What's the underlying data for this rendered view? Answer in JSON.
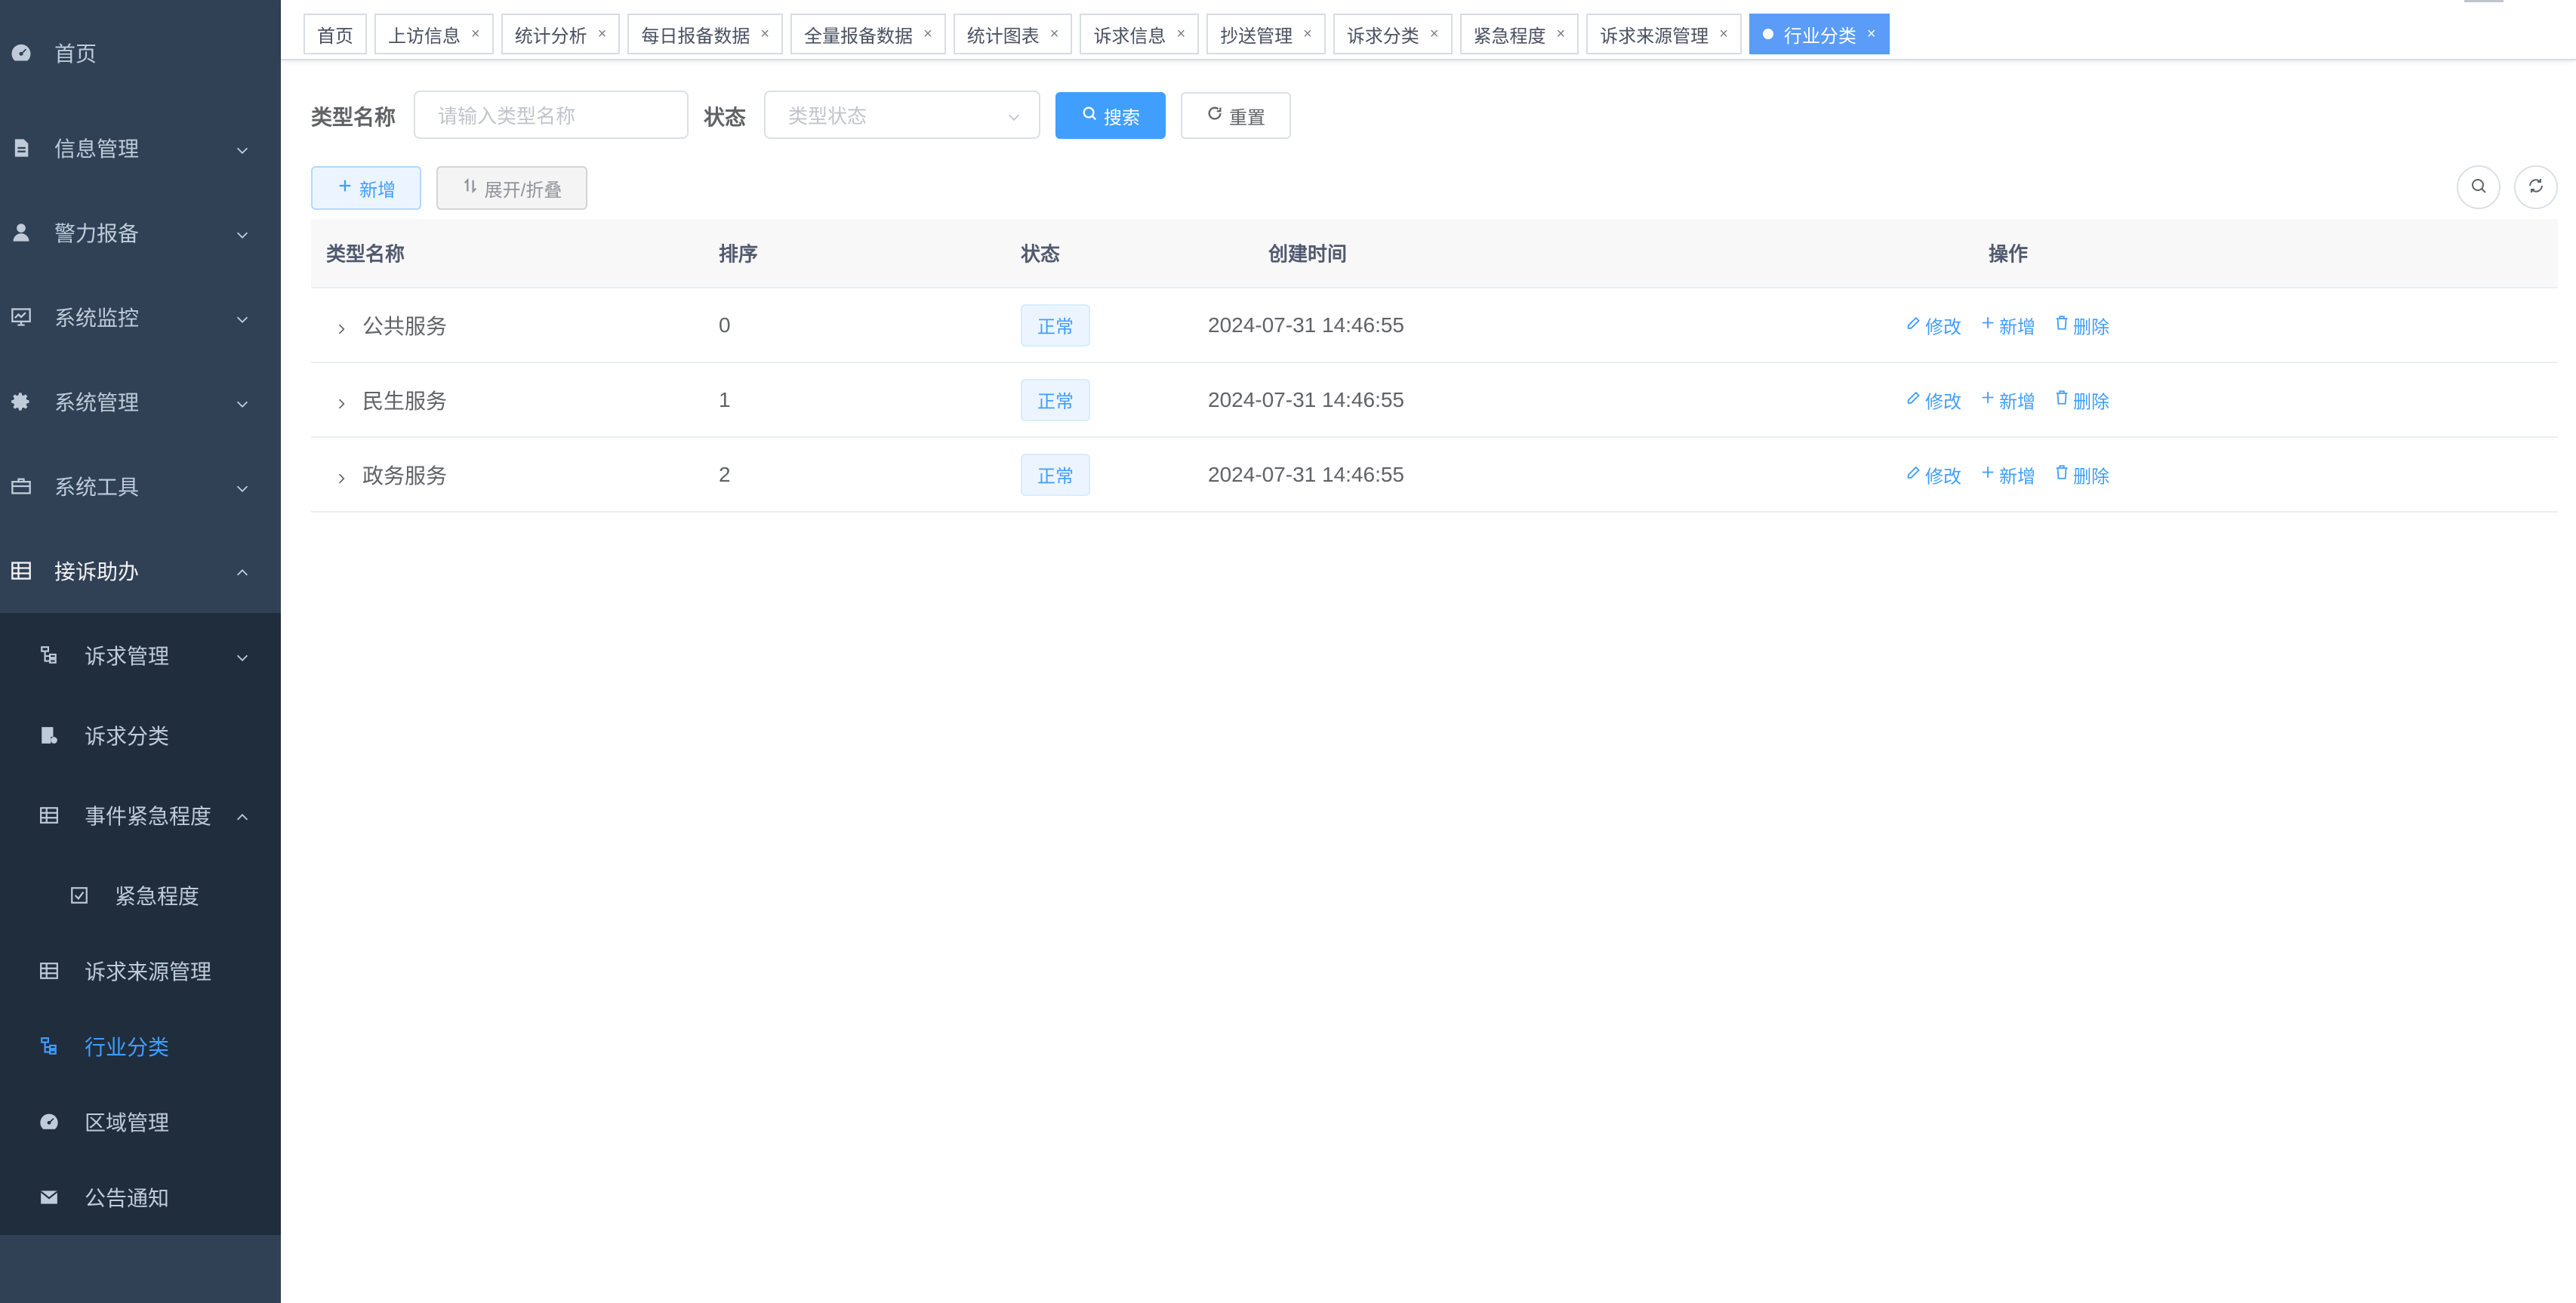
{
  "sidebar": {
    "menu": [
      {
        "label": "首页",
        "icon": "dashboard-icon"
      },
      {
        "label": "信息管理",
        "icon": "document-icon"
      },
      {
        "label": "警力报备",
        "icon": "user-icon"
      },
      {
        "label": "系统监控",
        "icon": "monitor-icon"
      },
      {
        "label": "系统管理",
        "icon": "gear-icon"
      },
      {
        "label": "系统工具",
        "icon": "toolbox-icon"
      },
      {
        "label": "接诉助办",
        "icon": "table-icon"
      }
    ],
    "submenu": [
      {
        "label": "诉求管理",
        "icon": "tree-icon"
      },
      {
        "label": "诉求分类",
        "icon": "form-icon"
      },
      {
        "label": "事件紧急程度",
        "icon": "table-icon"
      },
      {
        "label": "紧急程度",
        "icon": "checkbox-icon"
      },
      {
        "label": "诉求来源管理",
        "icon": "table-icon"
      },
      {
        "label": "行业分类",
        "icon": "tree-icon"
      },
      {
        "label": "区域管理",
        "icon": "dashboard-icon"
      },
      {
        "label": "公告通知",
        "icon": "mail-icon"
      }
    ]
  },
  "tags": [
    {
      "label": "首页"
    },
    {
      "label": "上访信息"
    },
    {
      "label": "统计分析"
    },
    {
      "label": "每日报备数据"
    },
    {
      "label": "全量报备数据"
    },
    {
      "label": "统计图表"
    },
    {
      "label": "诉求信息"
    },
    {
      "label": "抄送管理"
    },
    {
      "label": "诉求分类"
    },
    {
      "label": "紧急程度"
    },
    {
      "label": "诉求来源管理"
    },
    {
      "label": "行业分类"
    }
  ],
  "tag_close": "×",
  "search": {
    "name_label": "类型名称",
    "name_placeholder": "请输入类型名称",
    "status_label": "状态",
    "status_placeholder": "类型状态",
    "search_button": "搜索",
    "reset_button": "重置"
  },
  "toolbar": {
    "add_button": "新增",
    "expand_button": "展开/折叠"
  },
  "table": {
    "headers": {
      "name": "类型名称",
      "sort": "排序",
      "status": "状态",
      "created": "创建时间",
      "actions": "操作"
    },
    "rows": [
      {
        "name": "公共服务",
        "sort": "0",
        "status": "正常",
        "created": "2024-07-31 14:46:55"
      },
      {
        "name": "民生服务",
        "sort": "1",
        "status": "正常",
        "created": "2024-07-31 14:46:55"
      },
      {
        "name": "政务服务",
        "sort": "2",
        "status": "正常",
        "created": "2024-07-31 14:46:55"
      }
    ],
    "actions": {
      "edit": "修改",
      "add": "新增",
      "delete": "删除"
    }
  },
  "colors": {
    "sidebar_bg": "#304156",
    "submenu_bg": "#1f2d3d",
    "accent": "#409eff",
    "active_tag": "#5a9cf8"
  }
}
